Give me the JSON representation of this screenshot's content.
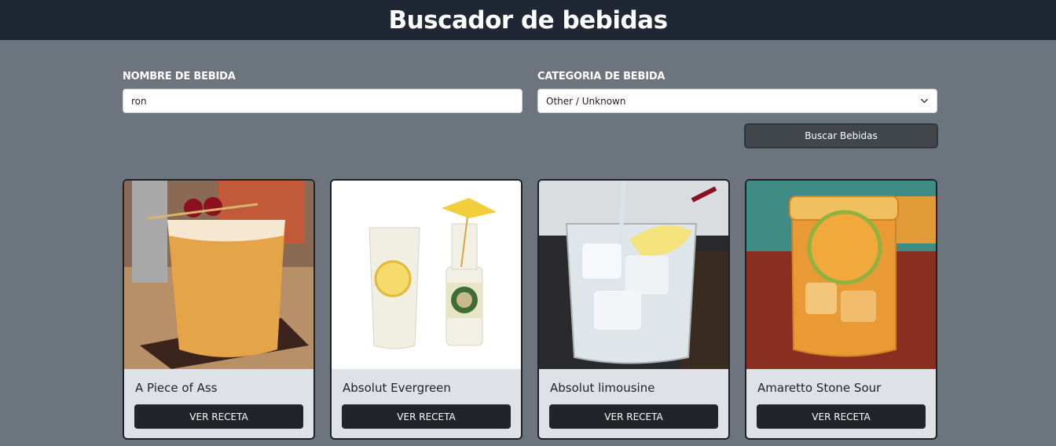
{
  "header": {
    "title": "Buscador de bebidas"
  },
  "form": {
    "name_label": "NOMBRE DE BEBIDA",
    "name_value": "ron",
    "category_label": "CATEGORIA DE BEBIDA",
    "category_value": "Other / Unknown",
    "search_button": "Buscar Bebidas"
  },
  "drinks": [
    {
      "name": "A Piece of Ass",
      "button": "VER RECETA"
    },
    {
      "name": "Absolut Evergreen",
      "button": "VER RECETA"
    },
    {
      "name": "Absolut limousine",
      "button": "VER RECETA"
    },
    {
      "name": "Amaretto Stone Sour",
      "button": "VER RECETA"
    }
  ]
}
